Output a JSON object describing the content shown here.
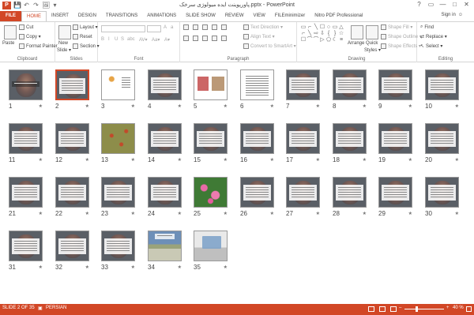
{
  "app": {
    "logo": "P",
    "title": "پاورپوینت ایده میولوژی سرخک.pptx - PowerPoint",
    "qat": [
      "💾",
      "↶",
      "↷",
      "🖼",
      "▾"
    ],
    "window_controls": [
      "?",
      "▭",
      "—",
      "□",
      "✕"
    ]
  },
  "ribbon": {
    "tabs": [
      "FILE",
      "HOME",
      "INSERT",
      "DESIGN",
      "TRANSITIONS",
      "ANIMATIONS",
      "SLIDE SHOW",
      "REVIEW",
      "VIEW",
      "FILEminimizer",
      "Nitro PDF Professional"
    ],
    "active_tab": "HOME",
    "signin": "Sign in",
    "clipboard": {
      "label": "Clipboard",
      "paste": "Paste",
      "cut": "Cut",
      "copy": "Copy ▾",
      "format_painter": "Format Painter"
    },
    "slides": {
      "label": "Slides",
      "new_slide": "New",
      "new_slide2": "Slide ▾",
      "layout": "Layout ▾",
      "reset": "Reset",
      "section": "Section ▾"
    },
    "font": {
      "label": "Font",
      "buttons": [
        "B",
        "I",
        "U",
        "S",
        "abc",
        "AV▾",
        "Aa▾",
        "A▾"
      ]
    },
    "paragraph": {
      "label": "Paragraph",
      "text_direction": "Text Direction ▾",
      "align_text": "Align Text ▾",
      "convert_smartart": "Convert to SmartArt ▾"
    },
    "drawing": {
      "label": "Drawing",
      "shapes": [
        "▭",
        "⌐",
        "╲",
        "☐",
        "○",
        "▭",
        "△",
        "⌐",
        "╲",
        "⇨",
        "⇩",
        "{",
        "}",
        "☆",
        "☐",
        "⌒",
        "⌒",
        "▷",
        "⬠",
        "☾",
        "≡"
      ],
      "arrange": "Arrange",
      "quick_styles": "Quick",
      "quick_styles2": "Styles ▾",
      "shape_fill": "Shape Fill ▾",
      "shape_outline": "Shape Outline ▾",
      "shape_effects": "Shape Effects ▾"
    },
    "editing": {
      "label": "Editing",
      "find": "Find",
      "replace": "Replace ▾",
      "select": "Select ▾"
    }
  },
  "slides": [
    {
      "n": "1",
      "kind": "title-only"
    },
    {
      "n": "2",
      "kind": "text",
      "selected": true
    },
    {
      "n": "3",
      "kind": "fish"
    },
    {
      "n": "4",
      "kind": "text"
    },
    {
      "n": "5",
      "kind": "photos"
    },
    {
      "n": "6",
      "kind": "white"
    },
    {
      "n": "7",
      "kind": "text"
    },
    {
      "n": "8",
      "kind": "text"
    },
    {
      "n": "9",
      "kind": "text"
    },
    {
      "n": "10",
      "kind": "text"
    },
    {
      "n": "11",
      "kind": "text"
    },
    {
      "n": "12",
      "kind": "text"
    },
    {
      "n": "13",
      "kind": "algae"
    },
    {
      "n": "14",
      "kind": "text"
    },
    {
      "n": "15",
      "kind": "text"
    },
    {
      "n": "16",
      "kind": "text"
    },
    {
      "n": "17",
      "kind": "text"
    },
    {
      "n": "18",
      "kind": "text"
    },
    {
      "n": "19",
      "kind": "text"
    },
    {
      "n": "20",
      "kind": "text"
    },
    {
      "n": "21",
      "kind": "text"
    },
    {
      "n": "22",
      "kind": "text"
    },
    {
      "n": "23",
      "kind": "text"
    },
    {
      "n": "24",
      "kind": "text"
    },
    {
      "n": "25",
      "kind": "flowers"
    },
    {
      "n": "26",
      "kind": "text"
    },
    {
      "n": "27",
      "kind": "text"
    },
    {
      "n": "28",
      "kind": "text"
    },
    {
      "n": "29",
      "kind": "text"
    },
    {
      "n": "30",
      "kind": "text"
    },
    {
      "n": "31",
      "kind": "text"
    },
    {
      "n": "32",
      "kind": "text"
    },
    {
      "n": "33",
      "kind": "text"
    },
    {
      "n": "34",
      "kind": "field"
    },
    {
      "n": "35",
      "kind": "laptop"
    }
  ],
  "slide_star": "★",
  "status": {
    "slide_info": "SLIDE 2 OF 35",
    "language": "PERSIAN",
    "zoom": "40 %",
    "zoom_minus": "–",
    "zoom_plus": "+"
  },
  "colors": {
    "accent": "#d24726"
  }
}
